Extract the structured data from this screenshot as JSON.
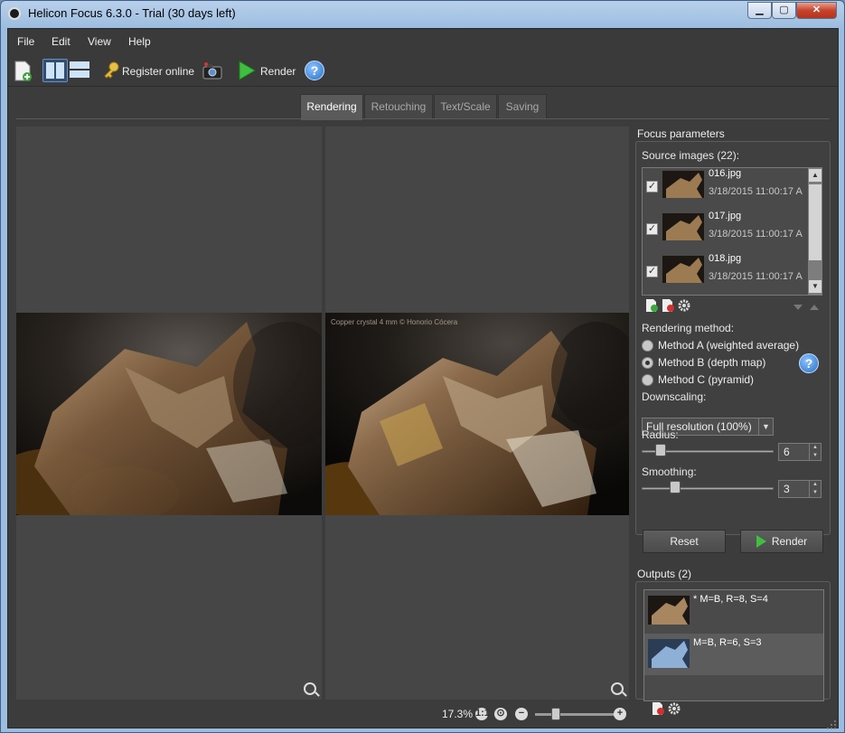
{
  "window": {
    "title": "Helicon Focus 6.3.0 - Trial (30 days left)",
    "controls": {
      "minimize": "▁",
      "maximize": "▢",
      "close": "✕"
    }
  },
  "menu": {
    "items": [
      "File",
      "Edit",
      "View",
      "Help"
    ]
  },
  "toolbar": {
    "register_label": "Register online",
    "render_label": "Render",
    "help_label": "?"
  },
  "tabs": [
    {
      "label": "Rendering",
      "active": true
    },
    {
      "label": "Retouching",
      "active": false
    },
    {
      "label": "Text/Scale",
      "active": false
    },
    {
      "label": "Saving",
      "active": false
    }
  ],
  "preview": {
    "caption": "Copper crystal 4 mm © Honorio Cócera"
  },
  "zoom": {
    "value": "17.3%",
    "level_fraction": 0.25
  },
  "focus_parameters": {
    "title": "Focus parameters",
    "source_label": "Source images (22):",
    "sources": [
      {
        "name": "016.jpg",
        "date": "3/18/2015 11:00:17 A",
        "checked": true
      },
      {
        "name": "017.jpg",
        "date": "3/18/2015 11:00:17 A",
        "checked": true
      },
      {
        "name": "018.jpg",
        "date": "3/18/2015 11:00:17 A",
        "checked": true
      }
    ],
    "rendering_method_label": "Rendering method:",
    "methods": [
      {
        "label": "Method A (weighted average)",
        "selected": false
      },
      {
        "label": "Method B (depth map)",
        "selected": true
      },
      {
        "label": "Method C (pyramid)",
        "selected": false
      }
    ],
    "downscaling_label": "Downscaling:",
    "downscaling_value": "Full resolution (100%)",
    "radius_label": "Radius:",
    "radius_value": "6",
    "smoothing_label": "Smoothing:",
    "smoothing_value": "3",
    "reset_label": "Reset",
    "render_label": "Render"
  },
  "outputs": {
    "title": "Outputs (2)",
    "items": [
      {
        "label": "* M=B, R=8, S=4",
        "selected": false
      },
      {
        "label": "M=B, R=6, S=3",
        "selected": true
      }
    ]
  },
  "colors": {
    "accent": "#3fbf3f",
    "panel": "#404040",
    "background": "#3c3c3c"
  }
}
